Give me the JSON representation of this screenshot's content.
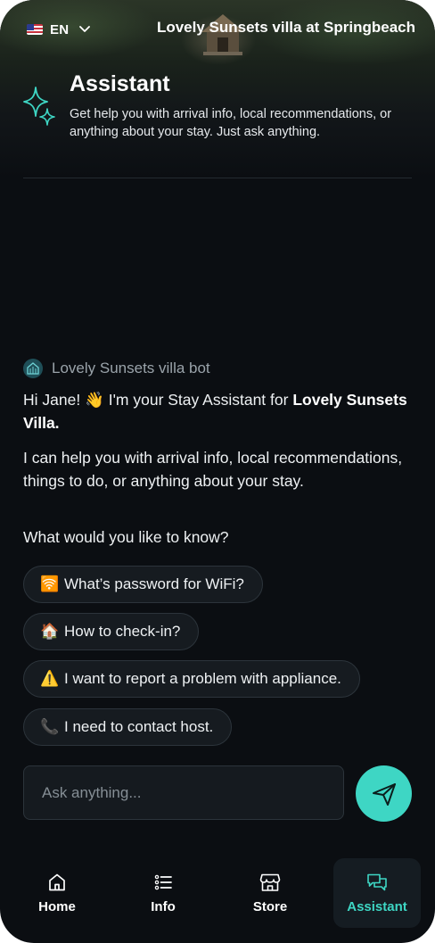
{
  "header": {
    "language": "EN",
    "villa_title": "Lovely Sunsets villa at Springbeach"
  },
  "assistant": {
    "title": "Assistant",
    "description": "Get help you with arrival info, local recommendations, or anything about your stay. Just ask anything."
  },
  "chat": {
    "bot_name": "Lovely Sunsets villa bot",
    "greeting_prefix": "Hi Jane! 👋 I'm your Stay Assistant for ",
    "greeting_bold": "Lovely Sunsets Villa.",
    "message_2": "I can help you with arrival info, local recommendations, things to do, or anything about your stay.",
    "message_3": "What would you like to know?",
    "suggestions": [
      {
        "emoji": "🛜",
        "label": "What’s password for WiFi?"
      },
      {
        "emoji": "🏠",
        "label": "How to check-in?"
      },
      {
        "emoji": "⚠️",
        "label": "I want to report a problem with appliance."
      },
      {
        "emoji": "📞",
        "label": "I need to contact host."
      }
    ]
  },
  "composer": {
    "placeholder": "Ask anything..."
  },
  "nav": {
    "items": [
      {
        "label": "Home"
      },
      {
        "label": "Info"
      },
      {
        "label": "Store"
      },
      {
        "label": "Assistant"
      }
    ]
  },
  "colors": {
    "accent": "#3ed6c4",
    "background": "#0b0e12"
  }
}
